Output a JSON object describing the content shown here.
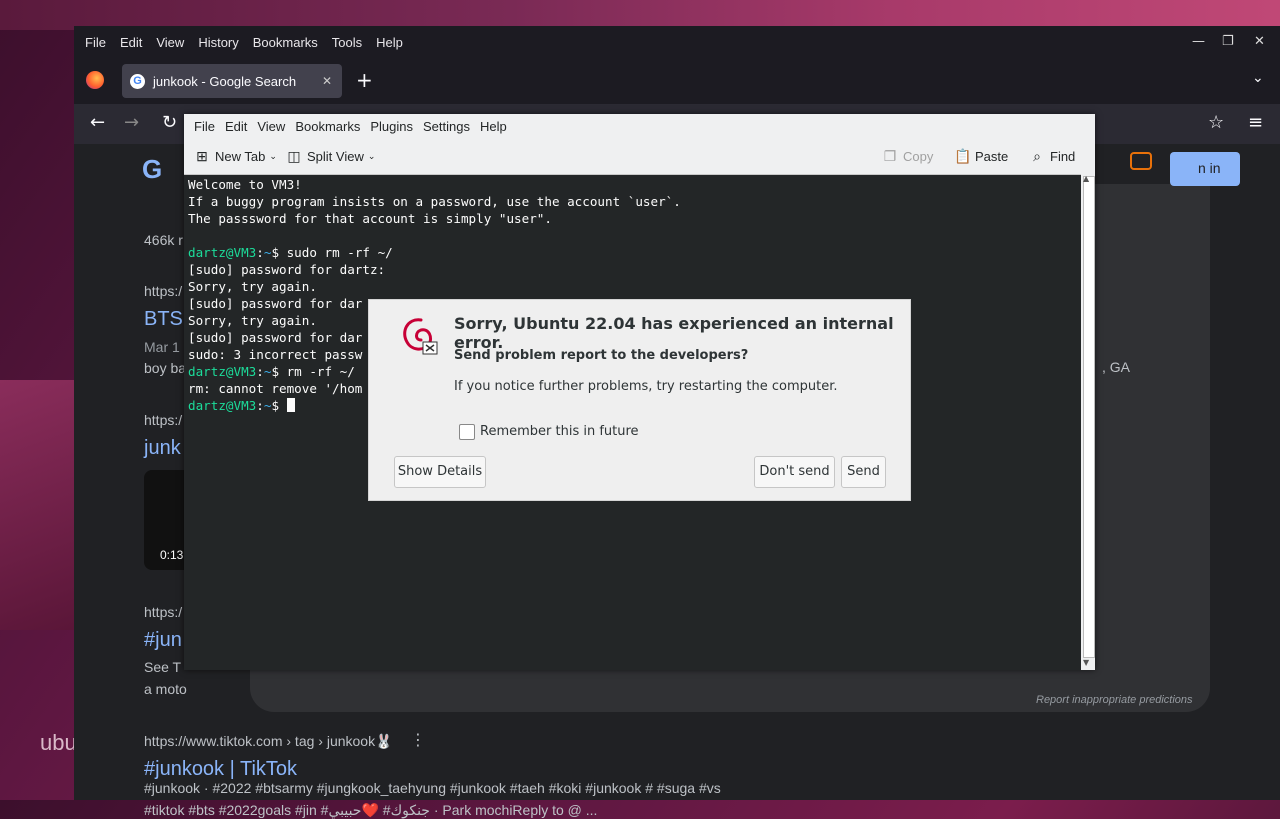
{
  "desktop": {
    "label": "ubu"
  },
  "firefox": {
    "menu": [
      "File",
      "Edit",
      "View",
      "History",
      "Bookmarks",
      "Tools",
      "Help"
    ],
    "window_controls": {
      "minimize": "—",
      "maximize": "❐",
      "close": "✕"
    },
    "tab": {
      "title": "junkook - Google Search",
      "close": "✕",
      "new_tab": "+"
    },
    "tab_list_icon": "chevron-down",
    "nav": {
      "back": "←",
      "forward": "→",
      "reload": "↻",
      "bookmark_star": "☆",
      "menu": "≡"
    },
    "google": {
      "logo_partial": "G",
      "signin_partial": "n in",
      "results_count_partial": "466k r",
      "results": [
        {
          "url_partial": "https:/",
          "title_partial": "BTS",
          "date_partial": "Mar 1 ",
          "snip_partial": "boy ba",
          "right_partial": ", GA"
        },
        {
          "url_partial": "https:/",
          "title_partial": "junk",
          "video_time": "0:13"
        },
        {
          "url_partial": "https:/",
          "title_partial": "#jun",
          "snip1_partial": "See T",
          "snip2_partial": "a moto"
        },
        {
          "url": "https://www.tiktok.com › tag › junkook🐰",
          "title": "#junkook | TikTok",
          "snip1": "#junkook · #2022 #btsarmy #jungkook_taehyung #junkook #taeh #koki #junkook # #suga #vs",
          "snip2": "#tiktok #bts #2022goals #jin #جنكوك# ❤️حبيبي · Park mochiReply to @ ..."
        }
      ],
      "report_link": "Report inappropriate predictions"
    }
  },
  "konsole": {
    "menu": [
      "File",
      "Edit",
      "View",
      "Bookmarks",
      "Plugins",
      "Settings",
      "Help"
    ],
    "toolbar": {
      "new_tab": "New Tab",
      "split_view": "Split View",
      "copy": "Copy",
      "paste": "Paste",
      "find": "Find"
    },
    "lines": [
      {
        "text": "Welcome to VM3!"
      },
      {
        "text": "If a buggy program insists on a password, use the account `user`."
      },
      {
        "text": "The passsword for that account is simply \"user\"."
      },
      {
        "text": ""
      },
      {
        "user": "dartz@VM3",
        "path": "~",
        "cmd": "$ sudo rm -rf ~/"
      },
      {
        "text": "[sudo] password for dartz:"
      },
      {
        "text": "Sorry, try again."
      },
      {
        "text": "[sudo] password for dar"
      },
      {
        "text": "Sorry, try again."
      },
      {
        "text": "[sudo] password for dar"
      },
      {
        "text": "sudo: 3 incorrect passw"
      },
      {
        "user": "dartz@VM3",
        "path": "~",
        "cmd": "$ rm -rf ~/"
      },
      {
        "text": "rm: cannot remove '/hom"
      },
      {
        "user": "dartz@VM3",
        "path": "~",
        "cmd": "$ "
      }
    ]
  },
  "dialog": {
    "title": "Sorry, Ubuntu 22.04 has experienced an internal error.",
    "question": "Send problem report to the developers?",
    "hint": "If you notice further problems, try restarting the computer.",
    "checkbox_label": "Remember this in future",
    "checkbox_checked": false,
    "buttons": {
      "details": "Show Details",
      "dont_send": "Don't send",
      "send": "Send"
    }
  }
}
